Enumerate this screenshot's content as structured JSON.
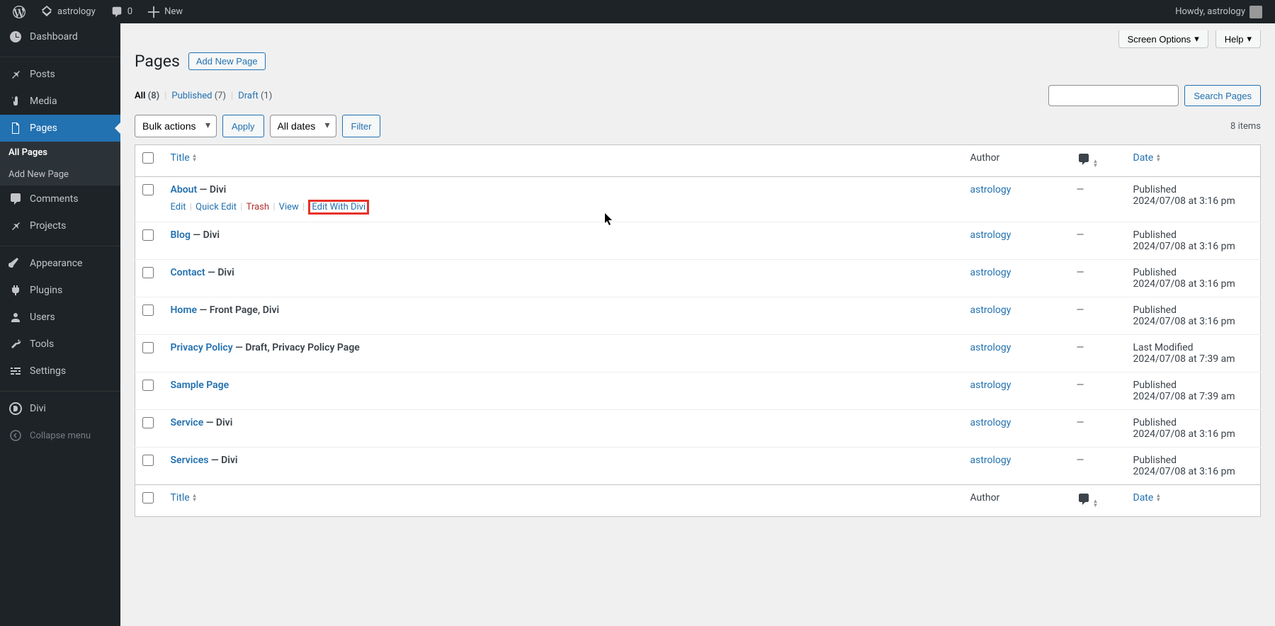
{
  "topbar": {
    "site_name": "astrology",
    "comment_count": "0",
    "new_label": "New",
    "greeting": "Howdy, astrology"
  },
  "sidebar": {
    "dashboard": "Dashboard",
    "posts": "Posts",
    "media": "Media",
    "pages": "Pages",
    "all_pages": "All Pages",
    "add_new": "Add New Page",
    "comments": "Comments",
    "projects": "Projects",
    "appearance": "Appearance",
    "plugins": "Plugins",
    "users": "Users",
    "tools": "Tools",
    "settings": "Settings",
    "divi": "Divi",
    "collapse": "Collapse menu"
  },
  "header": {
    "title": "Pages",
    "add_new": "Add New Page",
    "screen_options": "Screen Options",
    "help": "Help"
  },
  "filters": {
    "all_label": "All",
    "all_count": "(8)",
    "published_label": "Published",
    "published_count": "(7)",
    "draft_label": "Draft",
    "draft_count": "(1)",
    "bulk_actions": "Bulk actions",
    "apply": "Apply",
    "all_dates": "All dates",
    "filter": "Filter",
    "item_count": "8 items",
    "search_btn": "Search Pages"
  },
  "columns": {
    "title": "Title",
    "author": "Author",
    "date": "Date"
  },
  "row_actions": {
    "edit": "Edit",
    "quick_edit": "Quick Edit",
    "trash": "Trash",
    "view": "View",
    "edit_divi": "Edit With Divi"
  },
  "rows": [
    {
      "title": "About",
      "state": "— Divi",
      "author": "astrology",
      "comments": "—",
      "status": "Published",
      "date": "2024/07/08 at 3:16 pm",
      "show_actions": true
    },
    {
      "title": "Blog",
      "state": "— Divi",
      "author": "astrology",
      "comments": "—",
      "status": "Published",
      "date": "2024/07/08 at 3:16 pm",
      "show_actions": false
    },
    {
      "title": "Contact",
      "state": "— Divi",
      "author": "astrology",
      "comments": "—",
      "status": "Published",
      "date": "2024/07/08 at 3:16 pm",
      "show_actions": false
    },
    {
      "title": "Home",
      "state": "— Front Page, Divi",
      "author": "astrology",
      "comments": "—",
      "status": "Published",
      "date": "2024/07/08 at 3:16 pm",
      "show_actions": false
    },
    {
      "title": "Privacy Policy",
      "state": "— Draft, Privacy Policy Page",
      "author": "astrology",
      "comments": "—",
      "status": "Last Modified",
      "date": "2024/07/08 at 7:39 am",
      "show_actions": false
    },
    {
      "title": "Sample Page",
      "state": "",
      "author": "astrology",
      "comments": "—",
      "status": "Published",
      "date": "2024/07/08 at 7:39 am",
      "show_actions": false
    },
    {
      "title": "Service",
      "state": "— Divi",
      "author": "astrology",
      "comments": "—",
      "status": "Published",
      "date": "2024/07/08 at 3:16 pm",
      "show_actions": false
    },
    {
      "title": "Services",
      "state": "— Divi",
      "author": "astrology",
      "comments": "—",
      "status": "Published",
      "date": "2024/07/08 at 3:16 pm",
      "show_actions": false
    }
  ]
}
